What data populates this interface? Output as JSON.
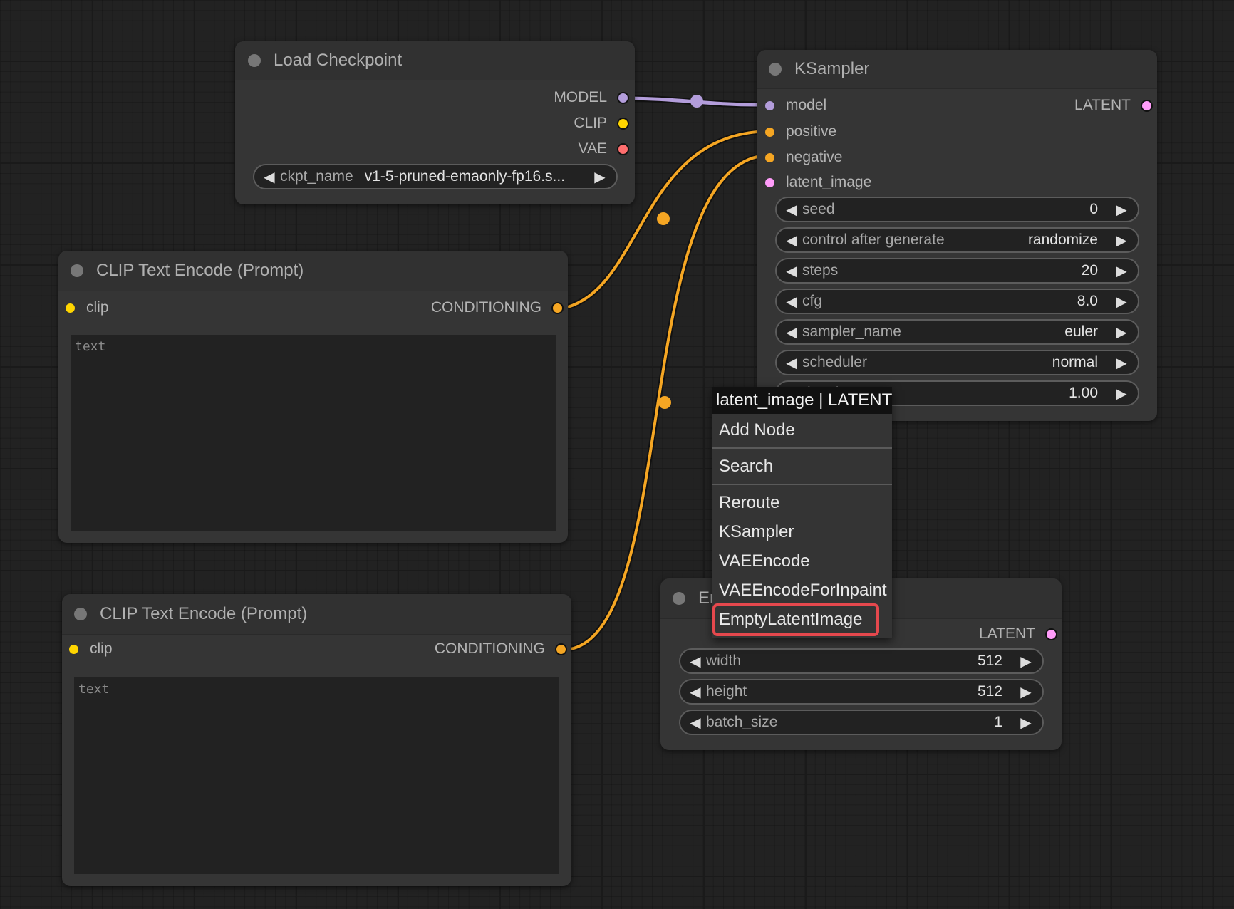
{
  "link_colors": {
    "MODEL": "#b39ddb",
    "CONDITIONING": "#f5a623",
    "CLIP": "#ffd500",
    "VAE": "#ff6e6e",
    "LATENT": "#ff9cf9"
  },
  "load_checkpoint": {
    "title": "Load Checkpoint",
    "outputs": [
      {
        "label": "MODEL",
        "type": "MODEL"
      },
      {
        "label": "CLIP",
        "type": "CLIP"
      },
      {
        "label": "VAE",
        "type": "VAE"
      }
    ],
    "widget": {
      "label": "ckpt_name",
      "value": "v1-5-pruned-emaonly-fp16.s..."
    }
  },
  "ksampler": {
    "title": "KSampler",
    "inputs": [
      {
        "label": "model",
        "type": "MODEL"
      },
      {
        "label": "positive",
        "type": "CONDITIONING"
      },
      {
        "label": "negative",
        "type": "CONDITIONING"
      },
      {
        "label": "latent_image",
        "type": "LATENT"
      }
    ],
    "output": {
      "label": "LATENT",
      "type": "LATENT"
    },
    "widgets": [
      {
        "label": "seed",
        "value": "0"
      },
      {
        "label": "control after generate",
        "value": "randomize"
      },
      {
        "label": "steps",
        "value": "20"
      },
      {
        "label": "cfg",
        "value": "8.0"
      },
      {
        "label": "sampler_name",
        "value": "euler"
      },
      {
        "label": "scheduler",
        "value": "normal"
      },
      {
        "label": "denoise",
        "value": "1.00"
      }
    ]
  },
  "clip_text_encode_1": {
    "title": "CLIP Text Encode (Prompt)",
    "input": {
      "label": "clip",
      "type": "CLIP"
    },
    "output": {
      "label": "CONDITIONING",
      "type": "CONDITIONING"
    },
    "text_placeholder": "text",
    "text_value": ""
  },
  "clip_text_encode_2": {
    "title": "CLIP Text Encode (Prompt)",
    "input": {
      "label": "clip",
      "type": "CLIP"
    },
    "output": {
      "label": "CONDITIONING",
      "type": "CONDITIONING"
    },
    "text_placeholder": "text",
    "text_value": ""
  },
  "empty_latent": {
    "title": "Empty Latent Image",
    "output": {
      "label": "LATENT",
      "type": "LATENT"
    },
    "widgets": [
      {
        "label": "width",
        "value": "512"
      },
      {
        "label": "height",
        "value": "512"
      },
      {
        "label": "batch_size",
        "value": "1"
      }
    ]
  },
  "context_menu": {
    "title": "latent_image | LATENT",
    "items": [
      {
        "label": "Add Node"
      },
      {
        "label": "Search"
      },
      {
        "label": "Reroute"
      },
      {
        "label": "KSampler"
      },
      {
        "label": "VAEEncode"
      },
      {
        "label": "VAEEncodeForInpaint"
      },
      {
        "label": "EmptyLatentImage",
        "highlighted": true
      }
    ],
    "highlight_color": "#e5484d"
  }
}
